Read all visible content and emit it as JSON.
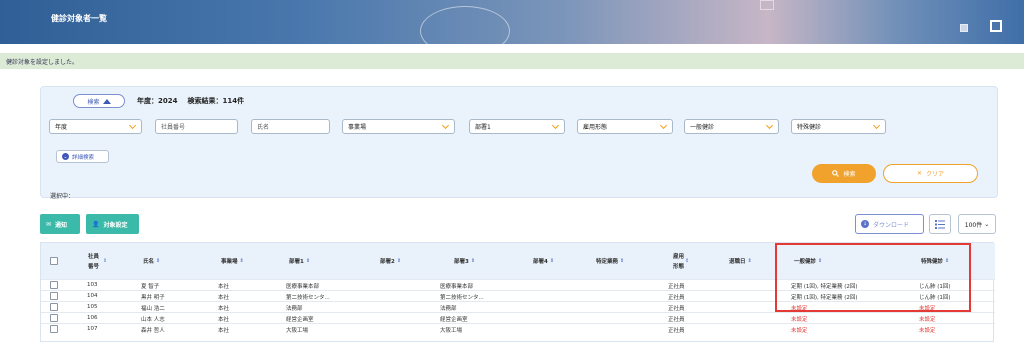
{
  "header": {
    "title": "健診対象者一覧"
  },
  "notice": {
    "text": "健診対象を設定しました。"
  },
  "search": {
    "toggle_label": "検索",
    "year_summary": "年度：2024",
    "result_summary": "検索結果：114件",
    "fields": {
      "year": "年度",
      "employee_no": "社員番号",
      "name": "氏名",
      "office": "事業場",
      "dept1": "部署1",
      "employment": "雇用形態",
      "general_checkup": "一般健診",
      "special_checkup": "特殊健診"
    },
    "advanced_label": "詳細検索",
    "selected_label": "選択中：",
    "search_button": "検索",
    "clear_button": "クリア"
  },
  "toolbar": {
    "notify_label": "通知",
    "target_label": "対象設定",
    "download_label": "ダウンロード",
    "page_size": "100件"
  },
  "table": {
    "headers": {
      "emp_no_1": "社員",
      "emp_no_2": "番号",
      "name": "氏名",
      "office": "事業場",
      "dept1": "部署1",
      "dept2": "部署2",
      "dept3": "部署3",
      "dept4": "部署4",
      "special_work": "特定業務",
      "employment_1": "雇用",
      "employment_2": "形態",
      "retire_date": "退職日",
      "general": "一般健診",
      "special": "特殊健診"
    },
    "rows": [
      {
        "no": "103",
        "name": "夏 智子",
        "office": "本社",
        "dept1": "医療事業本部",
        "dept3": "医療事業本部",
        "employment": "正社員",
        "general": "定期 (1回), 特定業務 (2回)",
        "special": "じん肺 (1回)",
        "unset": false
      },
      {
        "no": "104",
        "name": "黒井 明子",
        "office": "本社",
        "dept1": "第二技術センタ...",
        "dept3": "第二技術センタ...",
        "employment": "正社員",
        "general": "定期 (1回), 特定業務 (2回)",
        "special": "じん肺 (1回)",
        "unset": false
      },
      {
        "no": "105",
        "name": "福山 浩二",
        "office": "本社",
        "dept1": "法務部",
        "dept3": "法務部",
        "employment": "正社員",
        "general": "未設定",
        "special": "未設定",
        "unset": true
      },
      {
        "no": "106",
        "name": "山本 人志",
        "office": "本社",
        "dept1": "経営企画室",
        "dept3": "経営企画室",
        "employment": "正社員",
        "general": "未設定",
        "special": "未設定",
        "unset": true
      },
      {
        "no": "107",
        "name": "森井 哲人",
        "office": "本社",
        "dept1": "大阪工場",
        "dept3": "大阪工場",
        "employment": "正社員",
        "general": "未設定",
        "special": "未設定",
        "unset": true
      }
    ]
  },
  "colors": {
    "accent": "#f0a22c",
    "teal": "#3bb9a9",
    "unset": "#e53935"
  }
}
